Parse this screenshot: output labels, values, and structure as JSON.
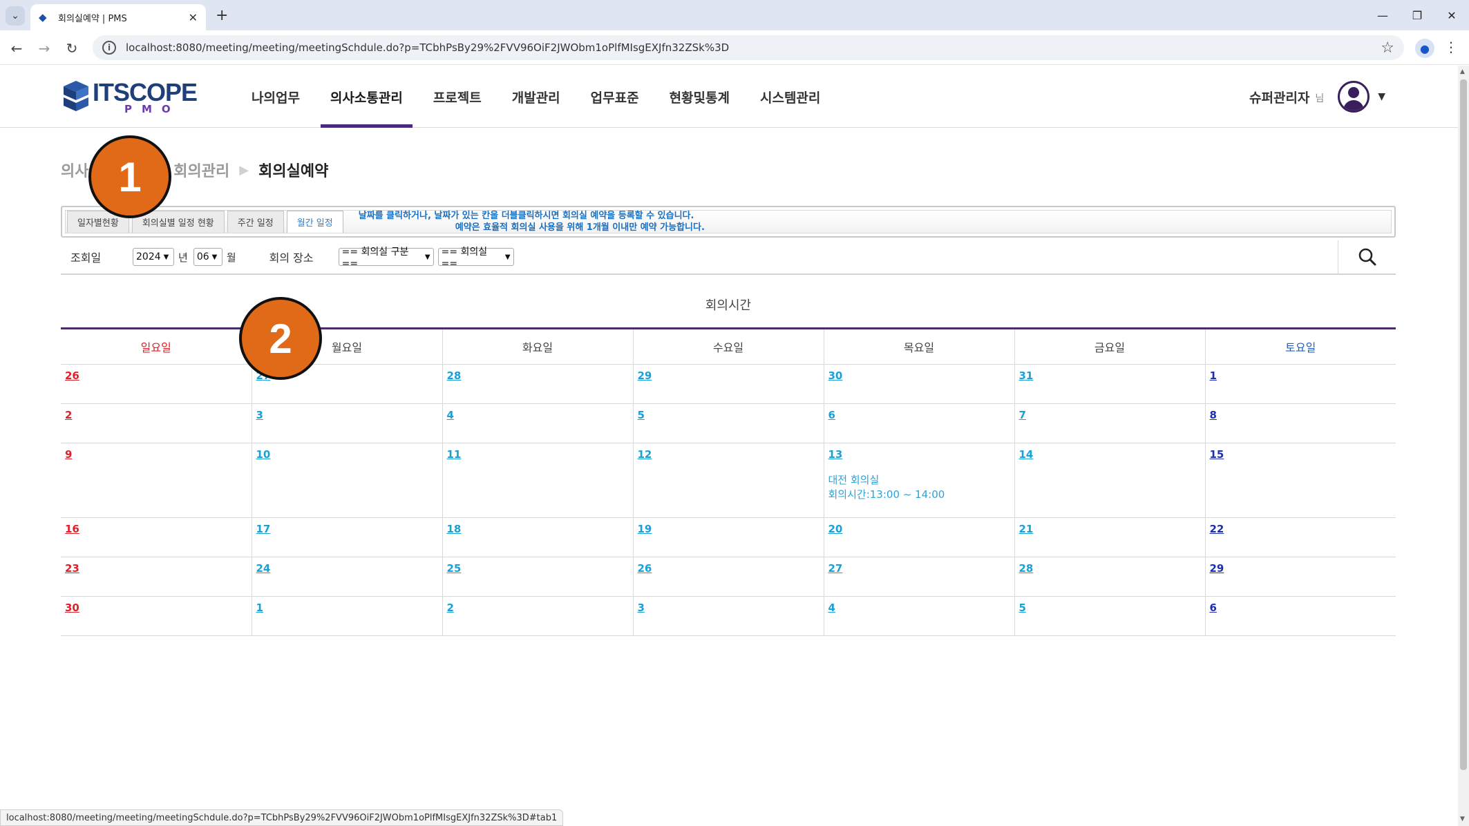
{
  "browser": {
    "tab_title": "회의실예약 | PMS",
    "url": "localhost:8080/meeting/meeting/meetingSchdule.do?p=TCbhPsBy29%2FVV96OiF2JWObm1oPlfMIsgEXJfn32ZSk%3D",
    "status_url": "localhost:8080/meeting/meeting/meetingSchdule.do?p=TCbhPsBy29%2FVV96OiF2JWObm1oPlfMIsgEXJfn32ZSk%3D#tab1"
  },
  "header": {
    "logo_text": "ITSCOPE",
    "logo_sub": "PMO",
    "menus": [
      "나의업무",
      "의사소통관리",
      "프로젝트",
      "개발관리",
      "업무표준",
      "현황및통계",
      "시스템관리"
    ],
    "active_menu_index": 1,
    "user_name": "슈퍼관리자",
    "user_suffix": "님"
  },
  "breadcrumb": {
    "items": [
      "의사소통관리",
      "회의관리",
      "회의실예약"
    ]
  },
  "subtabs": {
    "items": [
      "일자별현황",
      "회의실별 일정 현황",
      "주간 일정",
      "월간 일정"
    ],
    "active_index": 3,
    "notice_line1": "날짜를 클릭하거나, 날짜가 있는 칸을 더블클릭하시면 회의실 예약을 등록할 수 있습니다.",
    "notice_line2": "예약은 효율적 회의실 사용을 위해 1개월 이내만 예약 가능합니다."
  },
  "filter": {
    "date_label": "조회일",
    "year": "2024",
    "year_unit": "년",
    "month": "06",
    "month_unit": "월",
    "place_label": "회의 장소",
    "room_type_placeholder": "== 회의실 구분==",
    "room_placeholder": "== 회의실 =="
  },
  "calendar": {
    "title": "회의시간",
    "weekdays": [
      "일요일",
      "월요일",
      "화요일",
      "수요일",
      "목요일",
      "금요일",
      "토요일"
    ],
    "weeks": [
      [
        "26",
        "27",
        "28",
        "29",
        "30",
        "31",
        "1"
      ],
      [
        "2",
        "3",
        "4",
        "5",
        "6",
        "7",
        "8"
      ],
      [
        "9",
        "10",
        "11",
        "12",
        "13",
        "14",
        "15"
      ],
      [
        "16",
        "17",
        "18",
        "19",
        "20",
        "21",
        "22"
      ],
      [
        "23",
        "24",
        "25",
        "26",
        "27",
        "28",
        "29"
      ],
      [
        "30",
        "1",
        "2",
        "3",
        "4",
        "5",
        "6"
      ]
    ],
    "events": [
      {
        "week": 2,
        "day": 4,
        "room": "대전 회의실",
        "time": "회의시간:13:00 ~ 14:00"
      }
    ]
  },
  "markers": [
    "1",
    "2"
  ],
  "colors": {
    "accent": "#4a2a6a",
    "sunday": "#e0202a",
    "saturday": "#1b2fb0",
    "weekday_link": "#18a0d8",
    "marker": "#e06a17"
  }
}
